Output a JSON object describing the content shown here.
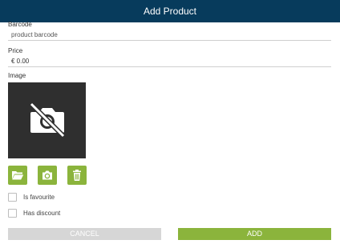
{
  "dialog": {
    "title": "Add Product"
  },
  "form": {
    "barcode": {
      "label": "Barcode",
      "placeholder": "product barcode"
    },
    "price": {
      "label": "Price",
      "value": "€ 0.00"
    },
    "image": {
      "label": "Image",
      "preview_icon": "no-photo-icon"
    }
  },
  "image_actions": [
    {
      "name": "open-folder-button",
      "icon": "folder-open-icon"
    },
    {
      "name": "take-photo-button",
      "icon": "camera-icon"
    },
    {
      "name": "delete-image-button",
      "icon": "trash-icon"
    }
  ],
  "checkboxes": {
    "favourite": {
      "label": "Is favourite",
      "checked": false
    },
    "discount": {
      "label": "Has discount",
      "checked": false
    }
  },
  "buttons": {
    "cancel": "CANCEL",
    "add": "ADD"
  },
  "colors": {
    "header": "#073b5c",
    "accent": "#8bb43c",
    "disabled": "#d6d6d6",
    "image_bg": "#2f2f2f"
  }
}
